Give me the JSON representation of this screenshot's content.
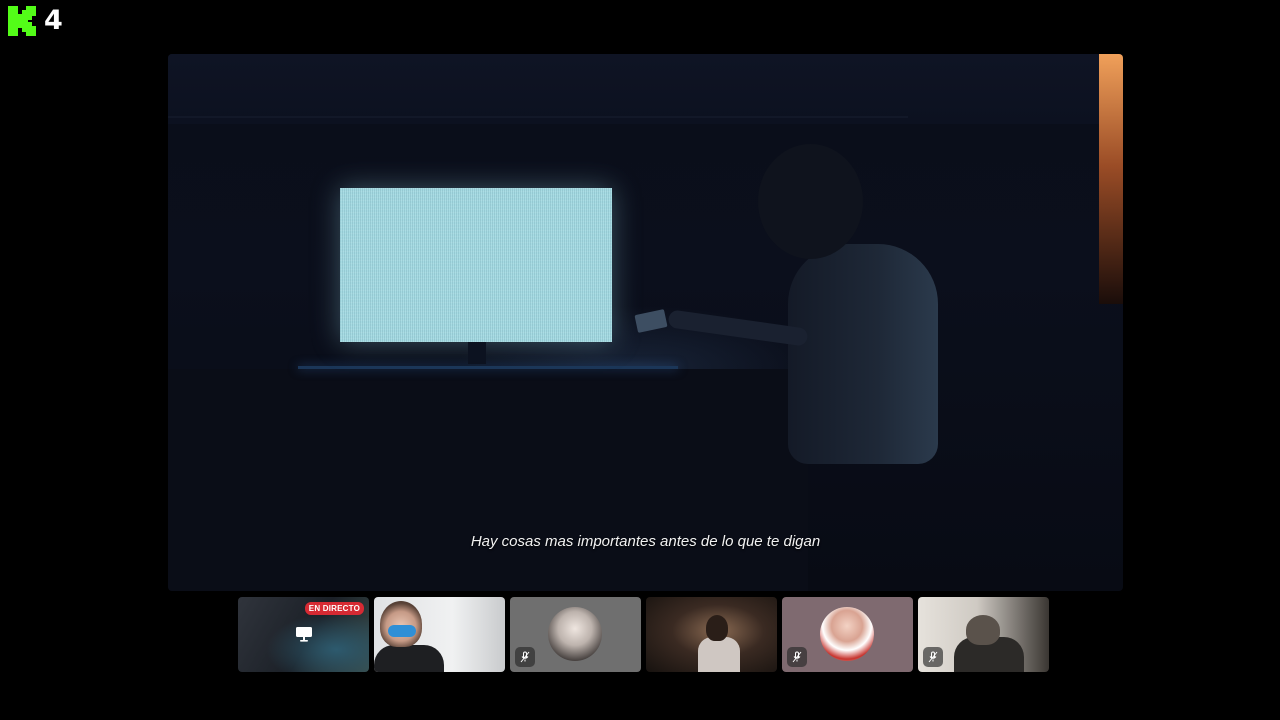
{
  "brand": {
    "viewer_count": "4",
    "logo_icon": "kick-logo-icon",
    "logo_color": "#53fc18"
  },
  "stage": {
    "subtitle": "Hay cosas mas importantes antes de lo que te digan"
  },
  "participants": [
    {
      "live_badge": "EN DIRECTO",
      "icon": "screen-share-icon",
      "badge_color": "#d62a33"
    },
    {
      "icon": "camera-feed"
    },
    {
      "icon": "mic-off-icon"
    },
    {
      "icon": "camera-feed"
    },
    {
      "icon": "mic-off-icon"
    },
    {
      "icon": "mic-off-icon"
    }
  ]
}
